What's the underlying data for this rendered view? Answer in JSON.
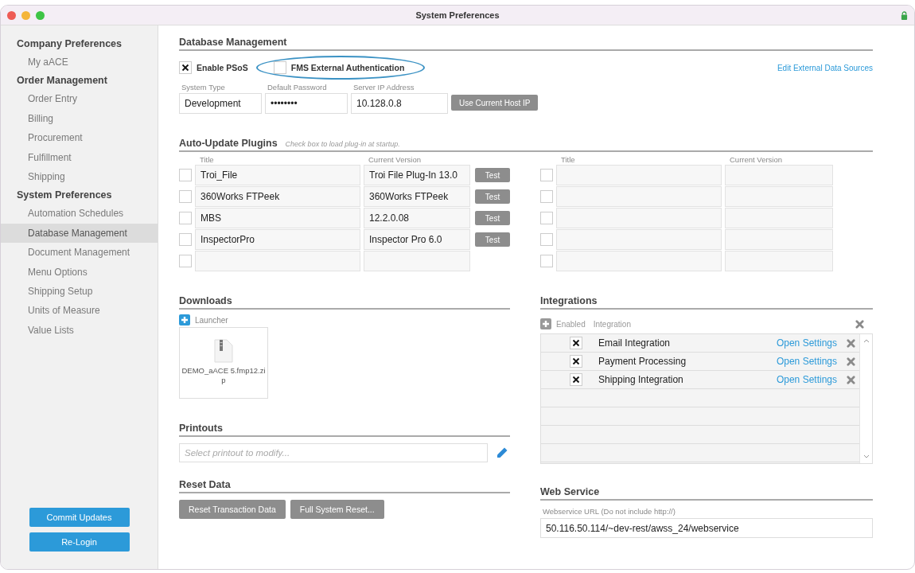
{
  "window": {
    "title": "System Preferences"
  },
  "sidebar": {
    "sections": [
      {
        "heading": "Company Preferences",
        "items": [
          {
            "label": "My aACE",
            "selected": false
          }
        ]
      },
      {
        "heading": "Order Management",
        "items": [
          {
            "label": "Order Entry",
            "selected": false
          },
          {
            "label": "Billing",
            "selected": false
          },
          {
            "label": "Procurement",
            "selected": false
          },
          {
            "label": "Fulfillment",
            "selected": false
          },
          {
            "label": "Shipping",
            "selected": false
          }
        ]
      },
      {
        "heading": "System Preferences",
        "items": [
          {
            "label": "Automation Schedules",
            "selected": false
          },
          {
            "label": "Database Management",
            "selected": true
          },
          {
            "label": "Document Management",
            "selected": false
          },
          {
            "label": "Menu Options",
            "selected": false
          },
          {
            "label": "Shipping Setup",
            "selected": false
          },
          {
            "label": "Units of Measure",
            "selected": false
          },
          {
            "label": "Value Lists",
            "selected": false
          }
        ]
      }
    ],
    "buttons": [
      "Commit Updates",
      "Re-Login"
    ]
  },
  "database_management": {
    "heading": "Database Management",
    "options": [
      {
        "label": "Enable PSoS",
        "checked": true,
        "circled": false
      },
      {
        "label": "FMS External Authentication",
        "checked": false,
        "circled": true
      }
    ],
    "link": "Edit External Data Sources",
    "fields": [
      {
        "label": "System Type",
        "value": "Development"
      },
      {
        "label": "Default Password",
        "value": "••••••••"
      },
      {
        "label": "Server IP Address",
        "value": "10.128.0.8"
      }
    ],
    "button": "Use Current Host IP"
  },
  "plugins": {
    "heading": "Auto-Update Plugins",
    "hint": "Check box to load plug-in at startup.",
    "tables": [
      {
        "columns": [
          "Title",
          "Current Version"
        ],
        "rows": [
          {
            "checked": false,
            "title": "Troi_File",
            "version": "Troi File Plug-In 13.0",
            "button": "Test"
          },
          {
            "checked": false,
            "title": "360Works FTPeek",
            "version": "360Works FTPeek",
            "button": "Test"
          },
          {
            "checked": false,
            "title": "MBS",
            "version": "12.2.0.08",
            "button": "Test"
          },
          {
            "checked": false,
            "title": "InspectorPro",
            "version": "Inspector Pro 6.0",
            "button": "Test"
          },
          {
            "checked": false
          }
        ]
      },
      {
        "columns": [
          "Title",
          "Current Version"
        ],
        "rows": [
          {
            "checked": false
          },
          {
            "checked": false
          },
          {
            "checked": false
          },
          {
            "checked": false
          },
          {
            "checked": false
          }
        ]
      }
    ]
  },
  "downloads": {
    "heading": "Downloads",
    "add_label": "Launcher",
    "files": [
      {
        "name": "DEMO_aACE 5.fmp12.zip"
      }
    ]
  },
  "printouts": {
    "heading": "Printouts",
    "placeholder": "Select printout to modify..."
  },
  "reset_data": {
    "heading": "Reset Data",
    "buttons": [
      "Reset Transaction Data",
      "Full System Reset..."
    ]
  },
  "integrations": {
    "heading": "Integrations",
    "columns": [
      "Enabled",
      "Integration"
    ],
    "rows": [
      {
        "enabled": true,
        "name": "Email Integration",
        "link": "Open Settings"
      },
      {
        "enabled": true,
        "name": "Payment Processing",
        "link": "Open Settings"
      },
      {
        "enabled": true,
        "name": "Shipping Integration",
        "link": "Open Settings"
      }
    ]
  },
  "web_service": {
    "heading": "Web Service",
    "label": "Webservice URL (Do not include http://)",
    "value": "50.116.50.114/~dev-rest/awss_24/webservice"
  }
}
